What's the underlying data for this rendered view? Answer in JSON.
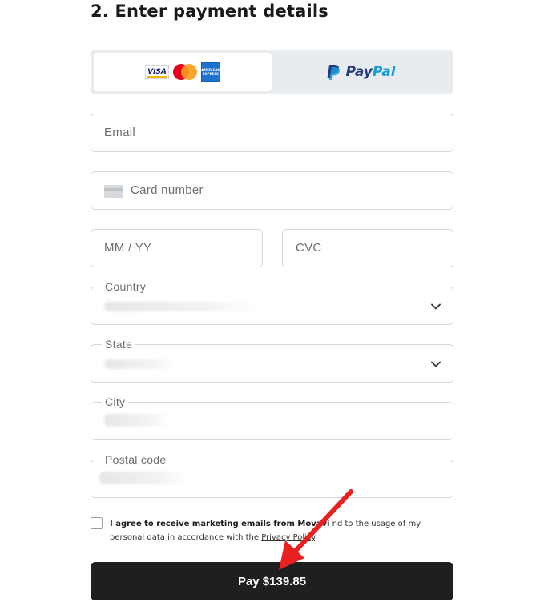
{
  "title": "2. Enter payment details",
  "methods": {
    "cards": {
      "visa": "VISA",
      "amex": "AMERICAN EXPRESS"
    },
    "paypal": {
      "pay": "Pay",
      "pal": "Pal"
    }
  },
  "fields": {
    "email": {
      "placeholder": "Email"
    },
    "card_number": {
      "placeholder": "Card number"
    },
    "expiry": {
      "placeholder": "MM / YY"
    },
    "cvc": {
      "placeholder": "CVC"
    },
    "country": {
      "label": "Country"
    },
    "state": {
      "label": "State"
    },
    "city": {
      "label": "City"
    },
    "postal_code": {
      "label": "Postal code"
    }
  },
  "consent": {
    "bold": "I agree to receive marketing emails from Movavi",
    "rest": "nd to the usage of my personal data in accordance with the",
    "link": "Privacy Policy",
    "end": "."
  },
  "pay_button": {
    "label": "Pay $139.85"
  },
  "colors": {
    "accent_button": "#1f1f1f",
    "annotation_arrow": "#e8201f",
    "paypal_dark": "#253b80",
    "paypal_light": "#179bd7"
  }
}
